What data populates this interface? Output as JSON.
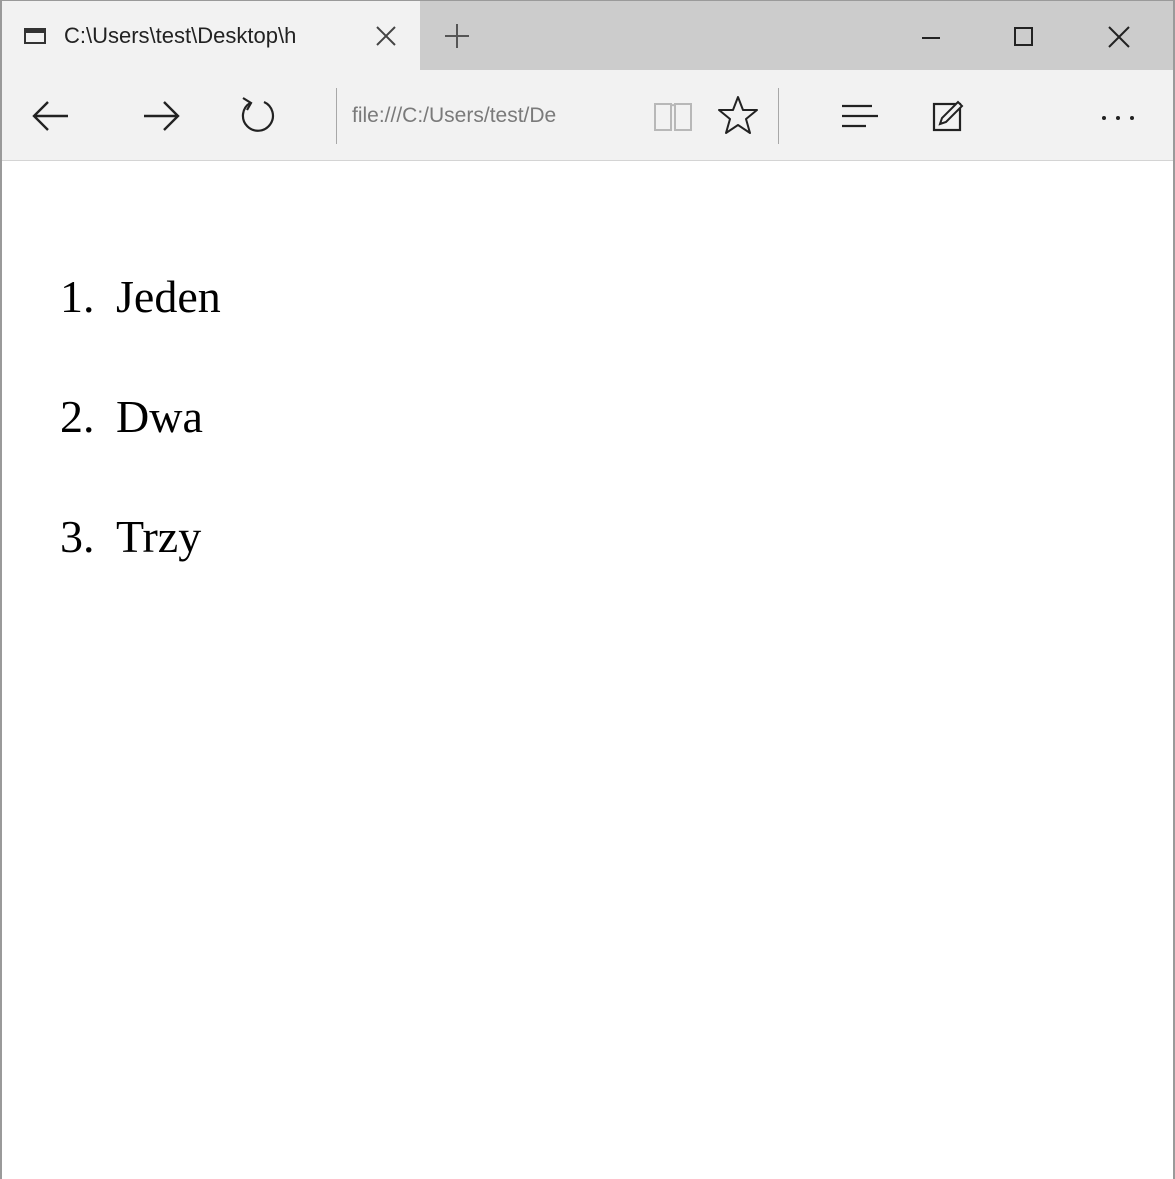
{
  "tab": {
    "title": "C:\\Users\\test\\Desktop\\h",
    "icon": "page-icon",
    "close_icon": "close-icon"
  },
  "new_tab_icon": "plus-icon",
  "window_controls": {
    "minimize_icon": "minimize-icon",
    "maximize_icon": "maximize-icon",
    "close_icon": "close-icon"
  },
  "toolbar": {
    "back_icon": "arrow-left-icon",
    "forward_icon": "arrow-right-icon",
    "refresh_icon": "refresh-icon",
    "address": "file:///C:/Users/test/De",
    "reading_view_icon": "book-icon",
    "favorite_icon": "star-icon",
    "hub_icon": "hub-lines-icon",
    "web_note_icon": "pen-note-icon",
    "more_icon": "ellipsis-icon"
  },
  "content": {
    "list": [
      {
        "number": "1.",
        "text": "Jeden"
      },
      {
        "number": "2.",
        "text": "Dwa"
      },
      {
        "number": "3.",
        "text": "Trzy"
      }
    ]
  },
  "colors": {
    "tab_bar": "#cccccc",
    "active_tab": "#f2f2f2",
    "toolbar": "#f2f2f2",
    "address_text": "#7a7a7a",
    "page_background": "#ffffff"
  }
}
